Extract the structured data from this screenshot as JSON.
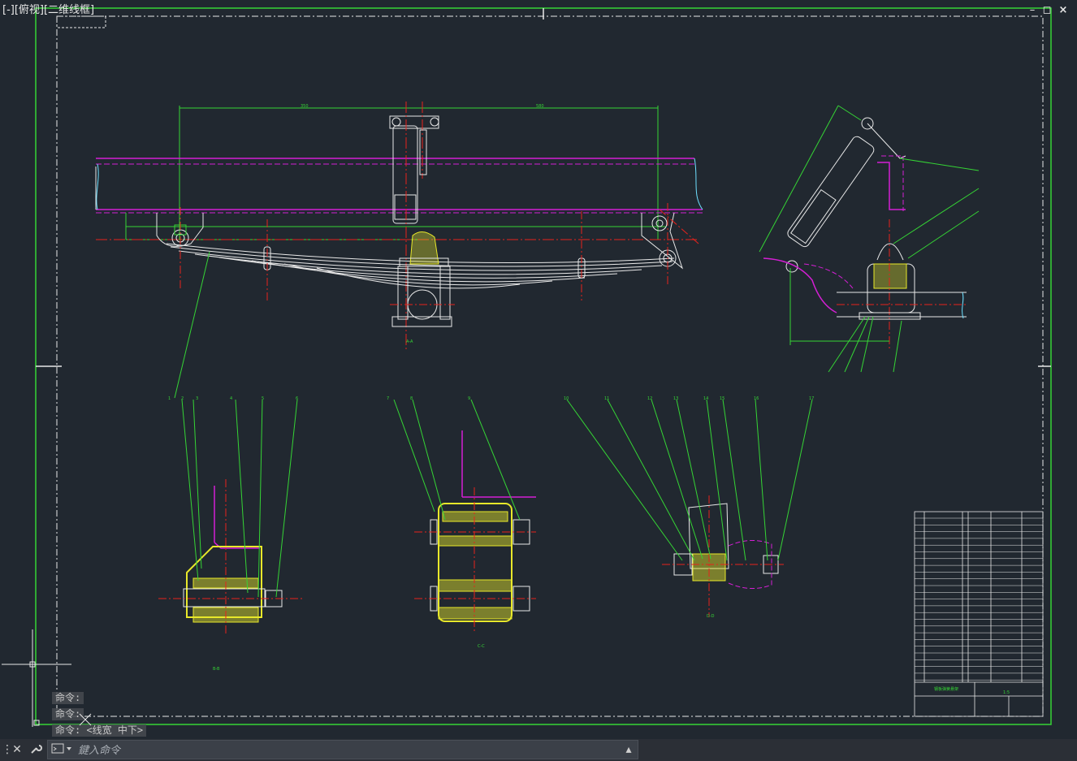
{
  "viewport": {
    "label": "[-][俯视][二维线框]"
  },
  "window_controls": {
    "minimize": "–",
    "restore": "◻",
    "close": "×"
  },
  "command_history": [
    "命令:",
    "命令:",
    "命令:  <线宽 中下>"
  ],
  "command_line": {
    "placeholder": "鍵入命令"
  },
  "colors": {
    "background": "#212830",
    "frame": "#35d435",
    "outline": "#ffffff",
    "centerline": "#e8221c",
    "hatch": "#e8e82a",
    "frame_purple": "#d41fd4",
    "dimension": "#35d435"
  },
  "drawing": {
    "part_numbers_left": [
      "1",
      "2",
      "3",
      "4",
      "5",
      "6"
    ],
    "part_numbers_mid": [
      "7",
      "8",
      "9"
    ],
    "part_numbers_right": [
      "10",
      "11",
      "12",
      "13",
      "14",
      "15",
      "16",
      "17"
    ],
    "title_block": {
      "drawing_title": "钢板弹簧悬架",
      "scale": "1:5"
    }
  }
}
